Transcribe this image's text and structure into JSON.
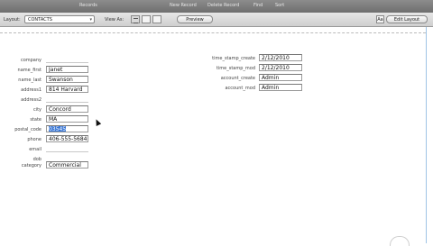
{
  "toolbar": {
    "records_label": "Records",
    "new_record": "New Record",
    "delete_record": "Delete Record",
    "find": "Find",
    "sort": "Sort"
  },
  "layoutbar": {
    "layout_label": "Layout:",
    "layout_value": "CONTACTS",
    "view_as_label": "View As:",
    "preview_button": "Preview",
    "aa_button": "Aa",
    "edit_layout_button": "Edit Layout"
  },
  "left_fields": [
    {
      "label": "company",
      "value": ""
    },
    {
      "label": "name_first",
      "value": "Janet"
    },
    {
      "label": "name_last",
      "value": "Swanson"
    },
    {
      "label": "address1",
      "value": "814 Harvard"
    },
    {
      "label": "address2",
      "value": ""
    },
    {
      "label": "city",
      "value": "Concord"
    },
    {
      "label": "state",
      "value": "MA"
    },
    {
      "label": "postal_code",
      "value": "03545"
    },
    {
      "label": "phone",
      "value": "406-555-5684"
    },
    {
      "label": "email",
      "value": ""
    },
    {
      "label": "dob",
      "value": ""
    },
    {
      "label": "category",
      "value": "Commercial"
    }
  ],
  "right_fields": [
    {
      "label": "time_stamp_create",
      "value": "2/12/2010"
    },
    {
      "label": "time_stamp_mod",
      "value": "2/12/2010"
    },
    {
      "label": "account_create",
      "value": "Admin"
    },
    {
      "label": "account_mod",
      "value": "Admin"
    }
  ],
  "icons": {
    "layout_dropdown": "chevron-down-icon",
    "view_form": "form-view-icon",
    "view_list": "list-view-icon",
    "view_table": "table-view-icon",
    "cursor": "mouse-pointer-icon",
    "busy": "spinner-icon"
  }
}
